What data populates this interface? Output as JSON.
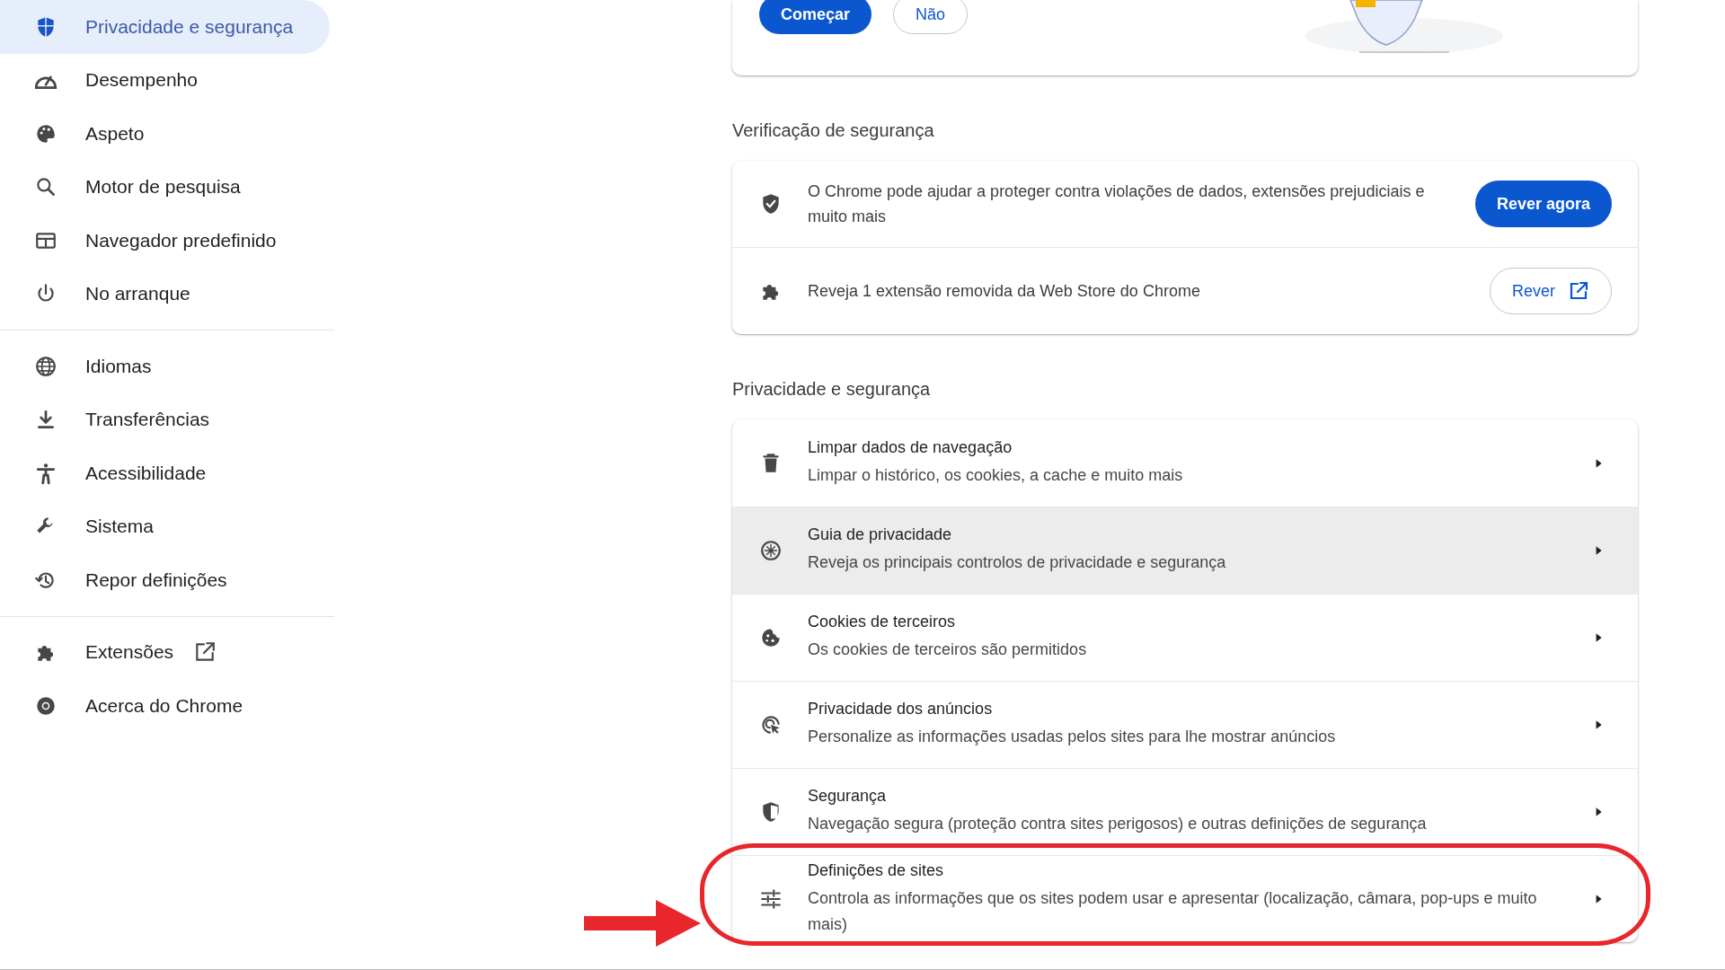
{
  "sidebar": {
    "groups": [
      {
        "items": [
          {
            "label": "Privacidade e segurança",
            "selected": true,
            "external_link": false
          },
          {
            "label": "Desempenho",
            "selected": false,
            "external_link": false
          },
          {
            "label": "Aspeto",
            "selected": false,
            "external_link": false
          },
          {
            "label": "Motor de pesquisa",
            "selected": false,
            "external_link": false
          },
          {
            "label": "Navegador predefinido",
            "selected": false,
            "external_link": false
          },
          {
            "label": "No arranque",
            "selected": false,
            "external_link": false
          }
        ]
      },
      {
        "items": [
          {
            "label": "Idiomas",
            "selected": false,
            "external_link": false
          },
          {
            "label": "Transferências",
            "selected": false,
            "external_link": false
          },
          {
            "label": "Acessibilidade",
            "selected": false,
            "external_link": false
          },
          {
            "label": "Sistema",
            "selected": false,
            "external_link": false
          },
          {
            "label": "Repor definições",
            "selected": false,
            "external_link": false
          }
        ]
      },
      {
        "items": [
          {
            "label": "Extensões",
            "selected": false,
            "external_link": true
          },
          {
            "label": "Acerca do Chrome",
            "selected": false,
            "external_link": false
          }
        ]
      }
    ]
  },
  "guide_card": {
    "buttons": [
      {
        "label": "Começar",
        "kind": "primary"
      },
      {
        "label": "Não",
        "kind": "outlined"
      }
    ]
  },
  "safety_check": {
    "heading": "Verificação de segurança",
    "rows": [
      {
        "text": "O Chrome pode ajudar a proteger contra violações de dados, extensões prejudiciais e muito mais",
        "button": {
          "label": "Rever agora",
          "kind": "primary",
          "external_link": false
        }
      },
      {
        "text": "Reveja 1 extensão removida da Web Store do Chrome",
        "button": {
          "label": "Rever",
          "kind": "outlined",
          "external_link": true
        }
      }
    ]
  },
  "privacy": {
    "heading": "Privacidade e segurança",
    "rows": [
      {
        "title": "Limpar dados de navegação",
        "subtitle": "Limpar o histórico, os cookies, a cache e muito mais",
        "hovered": false
      },
      {
        "title": "Guia de privacidade",
        "subtitle": "Reveja os principais controlos de privacidade e segurança",
        "hovered": true
      },
      {
        "title": "Cookies de terceiros",
        "subtitle": "Os cookies de terceiros são permitidos",
        "hovered": false
      },
      {
        "title": "Privacidade dos anúncios",
        "subtitle": "Personalize as informações usadas pelos sites para lhe mostrar anúncios",
        "hovered": false
      },
      {
        "title": "Segurança",
        "subtitle": "Navegação segura (proteção contra sites perigosos) e outras definições de segurança",
        "hovered": false
      },
      {
        "title": "Definições de sites",
        "subtitle": "Controla as informações que os sites podem usar e apresentar (localização, câmara, pop-ups e muito mais)",
        "hovered": false
      }
    ]
  }
}
